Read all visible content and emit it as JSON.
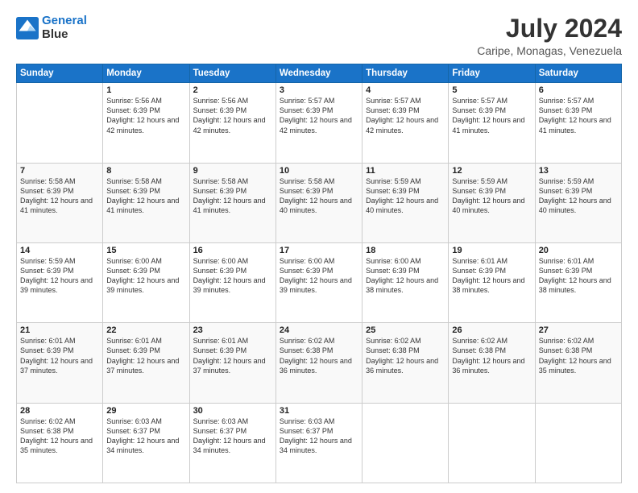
{
  "logo": {
    "line1": "General",
    "line2": "Blue"
  },
  "header": {
    "month_year": "July 2024",
    "location": "Caripe, Monagas, Venezuela"
  },
  "days_of_week": [
    "Sunday",
    "Monday",
    "Tuesday",
    "Wednesday",
    "Thursday",
    "Friday",
    "Saturday"
  ],
  "weeks": [
    [
      {
        "day": "",
        "sunrise": "",
        "sunset": "",
        "daylight": ""
      },
      {
        "day": "1",
        "sunrise": "Sunrise: 5:56 AM",
        "sunset": "Sunset: 6:39 PM",
        "daylight": "Daylight: 12 hours and 42 minutes."
      },
      {
        "day": "2",
        "sunrise": "Sunrise: 5:56 AM",
        "sunset": "Sunset: 6:39 PM",
        "daylight": "Daylight: 12 hours and 42 minutes."
      },
      {
        "day": "3",
        "sunrise": "Sunrise: 5:57 AM",
        "sunset": "Sunset: 6:39 PM",
        "daylight": "Daylight: 12 hours and 42 minutes."
      },
      {
        "day": "4",
        "sunrise": "Sunrise: 5:57 AM",
        "sunset": "Sunset: 6:39 PM",
        "daylight": "Daylight: 12 hours and 42 minutes."
      },
      {
        "day": "5",
        "sunrise": "Sunrise: 5:57 AM",
        "sunset": "Sunset: 6:39 PM",
        "daylight": "Daylight: 12 hours and 41 minutes."
      },
      {
        "day": "6",
        "sunrise": "Sunrise: 5:57 AM",
        "sunset": "Sunset: 6:39 PM",
        "daylight": "Daylight: 12 hours and 41 minutes."
      }
    ],
    [
      {
        "day": "7",
        "sunrise": "Sunrise: 5:58 AM",
        "sunset": "Sunset: 6:39 PM",
        "daylight": "Daylight: 12 hours and 41 minutes."
      },
      {
        "day": "8",
        "sunrise": "Sunrise: 5:58 AM",
        "sunset": "Sunset: 6:39 PM",
        "daylight": "Daylight: 12 hours and 41 minutes."
      },
      {
        "day": "9",
        "sunrise": "Sunrise: 5:58 AM",
        "sunset": "Sunset: 6:39 PM",
        "daylight": "Daylight: 12 hours and 41 minutes."
      },
      {
        "day": "10",
        "sunrise": "Sunrise: 5:58 AM",
        "sunset": "Sunset: 6:39 PM",
        "daylight": "Daylight: 12 hours and 40 minutes."
      },
      {
        "day": "11",
        "sunrise": "Sunrise: 5:59 AM",
        "sunset": "Sunset: 6:39 PM",
        "daylight": "Daylight: 12 hours and 40 minutes."
      },
      {
        "day": "12",
        "sunrise": "Sunrise: 5:59 AM",
        "sunset": "Sunset: 6:39 PM",
        "daylight": "Daylight: 12 hours and 40 minutes."
      },
      {
        "day": "13",
        "sunrise": "Sunrise: 5:59 AM",
        "sunset": "Sunset: 6:39 PM",
        "daylight": "Daylight: 12 hours and 40 minutes."
      }
    ],
    [
      {
        "day": "14",
        "sunrise": "Sunrise: 5:59 AM",
        "sunset": "Sunset: 6:39 PM",
        "daylight": "Daylight: 12 hours and 39 minutes."
      },
      {
        "day": "15",
        "sunrise": "Sunrise: 6:00 AM",
        "sunset": "Sunset: 6:39 PM",
        "daylight": "Daylight: 12 hours and 39 minutes."
      },
      {
        "day": "16",
        "sunrise": "Sunrise: 6:00 AM",
        "sunset": "Sunset: 6:39 PM",
        "daylight": "Daylight: 12 hours and 39 minutes."
      },
      {
        "day": "17",
        "sunrise": "Sunrise: 6:00 AM",
        "sunset": "Sunset: 6:39 PM",
        "daylight": "Daylight: 12 hours and 39 minutes."
      },
      {
        "day": "18",
        "sunrise": "Sunrise: 6:00 AM",
        "sunset": "Sunset: 6:39 PM",
        "daylight": "Daylight: 12 hours and 38 minutes."
      },
      {
        "day": "19",
        "sunrise": "Sunrise: 6:01 AM",
        "sunset": "Sunset: 6:39 PM",
        "daylight": "Daylight: 12 hours and 38 minutes."
      },
      {
        "day": "20",
        "sunrise": "Sunrise: 6:01 AM",
        "sunset": "Sunset: 6:39 PM",
        "daylight": "Daylight: 12 hours and 38 minutes."
      }
    ],
    [
      {
        "day": "21",
        "sunrise": "Sunrise: 6:01 AM",
        "sunset": "Sunset: 6:39 PM",
        "daylight": "Daylight: 12 hours and 37 minutes."
      },
      {
        "day": "22",
        "sunrise": "Sunrise: 6:01 AM",
        "sunset": "Sunset: 6:39 PM",
        "daylight": "Daylight: 12 hours and 37 minutes."
      },
      {
        "day": "23",
        "sunrise": "Sunrise: 6:01 AM",
        "sunset": "Sunset: 6:39 PM",
        "daylight": "Daylight: 12 hours and 37 minutes."
      },
      {
        "day": "24",
        "sunrise": "Sunrise: 6:02 AM",
        "sunset": "Sunset: 6:38 PM",
        "daylight": "Daylight: 12 hours and 36 minutes."
      },
      {
        "day": "25",
        "sunrise": "Sunrise: 6:02 AM",
        "sunset": "Sunset: 6:38 PM",
        "daylight": "Daylight: 12 hours and 36 minutes."
      },
      {
        "day": "26",
        "sunrise": "Sunrise: 6:02 AM",
        "sunset": "Sunset: 6:38 PM",
        "daylight": "Daylight: 12 hours and 36 minutes."
      },
      {
        "day": "27",
        "sunrise": "Sunrise: 6:02 AM",
        "sunset": "Sunset: 6:38 PM",
        "daylight": "Daylight: 12 hours and 35 minutes."
      }
    ],
    [
      {
        "day": "28",
        "sunrise": "Sunrise: 6:02 AM",
        "sunset": "Sunset: 6:38 PM",
        "daylight": "Daylight: 12 hours and 35 minutes."
      },
      {
        "day": "29",
        "sunrise": "Sunrise: 6:03 AM",
        "sunset": "Sunset: 6:37 PM",
        "daylight": "Daylight: 12 hours and 34 minutes."
      },
      {
        "day": "30",
        "sunrise": "Sunrise: 6:03 AM",
        "sunset": "Sunset: 6:37 PM",
        "daylight": "Daylight: 12 hours and 34 minutes."
      },
      {
        "day": "31",
        "sunrise": "Sunrise: 6:03 AM",
        "sunset": "Sunset: 6:37 PM",
        "daylight": "Daylight: 12 hours and 34 minutes."
      },
      {
        "day": "",
        "sunrise": "",
        "sunset": "",
        "daylight": ""
      },
      {
        "day": "",
        "sunrise": "",
        "sunset": "",
        "daylight": ""
      },
      {
        "day": "",
        "sunrise": "",
        "sunset": "",
        "daylight": ""
      }
    ]
  ]
}
